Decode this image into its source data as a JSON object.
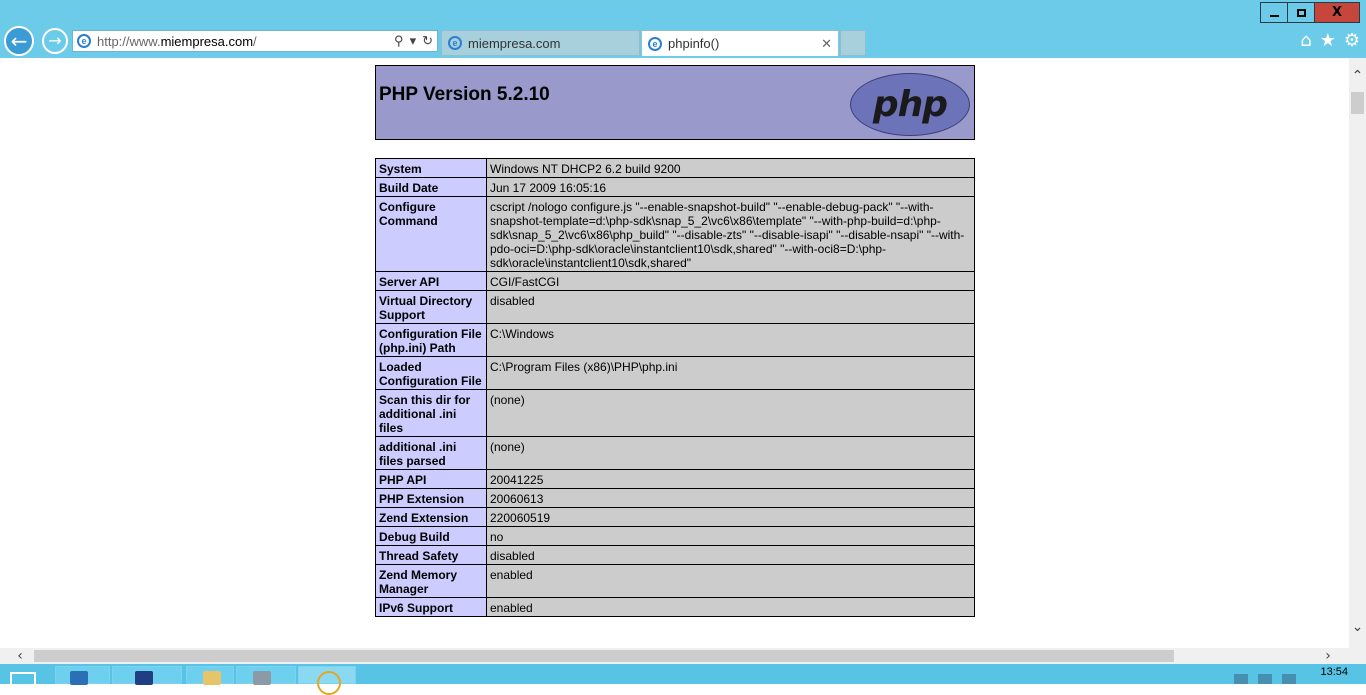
{
  "browser": {
    "address_url": "http://www.miempresa.com/",
    "tabs": [
      {
        "label": "miempresa.com",
        "active": false
      },
      {
        "label": "phpinfo()",
        "active": true
      }
    ],
    "window_controls": {
      "close_glyph": "X"
    },
    "icons": [
      "back-icon",
      "forward-icon",
      "search-icon",
      "refresh-icon",
      "home-icon",
      "favorites-star-icon",
      "settings-gear-icon"
    ]
  },
  "page": {
    "heading": "PHP Version 5.2.10",
    "logo_text": "php",
    "rows": [
      {
        "key": "System",
        "value": "Windows NT DHCP2 6.2 build 9200"
      },
      {
        "key": "Build Date",
        "value": "Jun 17 2009 16:05:16"
      },
      {
        "key": "Configure Command",
        "value": "cscript /nologo configure.js \"--enable-snapshot-build\" \"--enable-debug-pack\" \"--with-snapshot-template=d:\\php-sdk\\snap_5_2\\vc6\\x86\\template\" \"--with-php-build=d:\\php-sdk\\snap_5_2\\vc6\\x86\\php_build\" \"--disable-zts\" \"--disable-isapi\" \"--disable-nsapi\" \"--with-pdo-oci=D:\\php-sdk\\oracle\\instantclient10\\sdk,shared\" \"--with-oci8=D:\\php-sdk\\oracle\\instantclient10\\sdk,shared\""
      },
      {
        "key": "Server API",
        "value": "CGI/FastCGI"
      },
      {
        "key": "Virtual Directory Support",
        "value": "disabled"
      },
      {
        "key": "Configuration File (php.ini) Path",
        "value": "C:\\Windows"
      },
      {
        "key": "Loaded Configuration File",
        "value": "C:\\Program Files (x86)\\PHP\\php.ini"
      },
      {
        "key": "Scan this dir for additional .ini files",
        "value": "(none)"
      },
      {
        "key": "additional .ini files parsed",
        "value": "(none)"
      },
      {
        "key": "PHP API",
        "value": "20041225"
      },
      {
        "key": "PHP Extension",
        "value": "20060613"
      },
      {
        "key": "Zend Extension",
        "value": "220060519"
      },
      {
        "key": "Debug Build",
        "value": "no"
      },
      {
        "key": "Thread Safety",
        "value": "disabled"
      },
      {
        "key": "Zend Memory Manager",
        "value": "enabled"
      },
      {
        "key": "IPv6 Support",
        "value": "enabled"
      }
    ]
  },
  "taskbar": {
    "clock": "13:54",
    "apps": [
      "start-button",
      "server-manager",
      "powershell",
      "file-explorer",
      "administrative-tools",
      "internet-explorer"
    ]
  },
  "colors": {
    "chrome": "#6bcbe9",
    "php_header": "#9999cc",
    "php_key_cell": "#ccccff",
    "php_value_cell": "#cccccc",
    "close_button": "#c7463b"
  }
}
